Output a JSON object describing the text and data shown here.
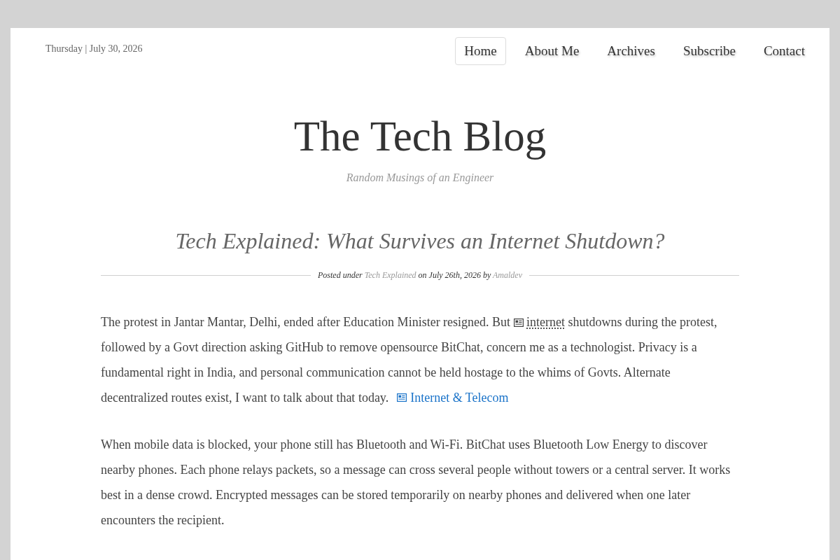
{
  "header": {
    "date": "Thursday | July 30, 2026"
  },
  "nav": [
    {
      "label": "Home",
      "selected": true
    },
    {
      "label": "About Me",
      "selected": false
    },
    {
      "label": "Archives",
      "selected": false
    },
    {
      "label": "Subscribe",
      "selected": false
    },
    {
      "label": "Contact",
      "selected": false
    }
  ],
  "site": {
    "title": "The Tech Blog",
    "tagline": "Random Musings of an Engineer"
  },
  "post": {
    "title": "Tech Explained: What Survives an Internet Shutdown?",
    "meta": {
      "prefix": "Posted under",
      "category": "Tech Explained",
      "date_text": "on July 26th, 2026 by",
      "author": "Amaldev"
    },
    "paragraphs": [
      {
        "parts": [
          {
            "kind": "text",
            "text": "The protest in Jantar Mantar, Delhi, ended after Education Minister resigned. But "
          },
          {
            "kind": "keyword",
            "text": "internet"
          },
          {
            "kind": "text",
            "text": " shutdowns during the protest, followed by a Govt direction asking GitHub to remove opensource BitChat, concern me as a technologist. Privacy is a fundamental right in India, and personal communication cannot be held hostage to the whims of Govts. Alternate decentralized routes exist, I want to talk about that today."
          },
          {
            "kind": "topic",
            "text": "Internet & Telecom"
          }
        ]
      },
      {
        "parts": [
          {
            "kind": "text",
            "text": "When mobile data is blocked, your phone still has Bluetooth and Wi-Fi. BitChat uses Bluetooth Low Energy to discover nearby phones. Each phone relays packets, so a message can cross several people without towers or a central server. It works best in a dense crowd. Encrypted messages can be stored temporarily on nearby phones and delivered when one later encounters the recipient."
          }
        ]
      }
    ]
  }
}
